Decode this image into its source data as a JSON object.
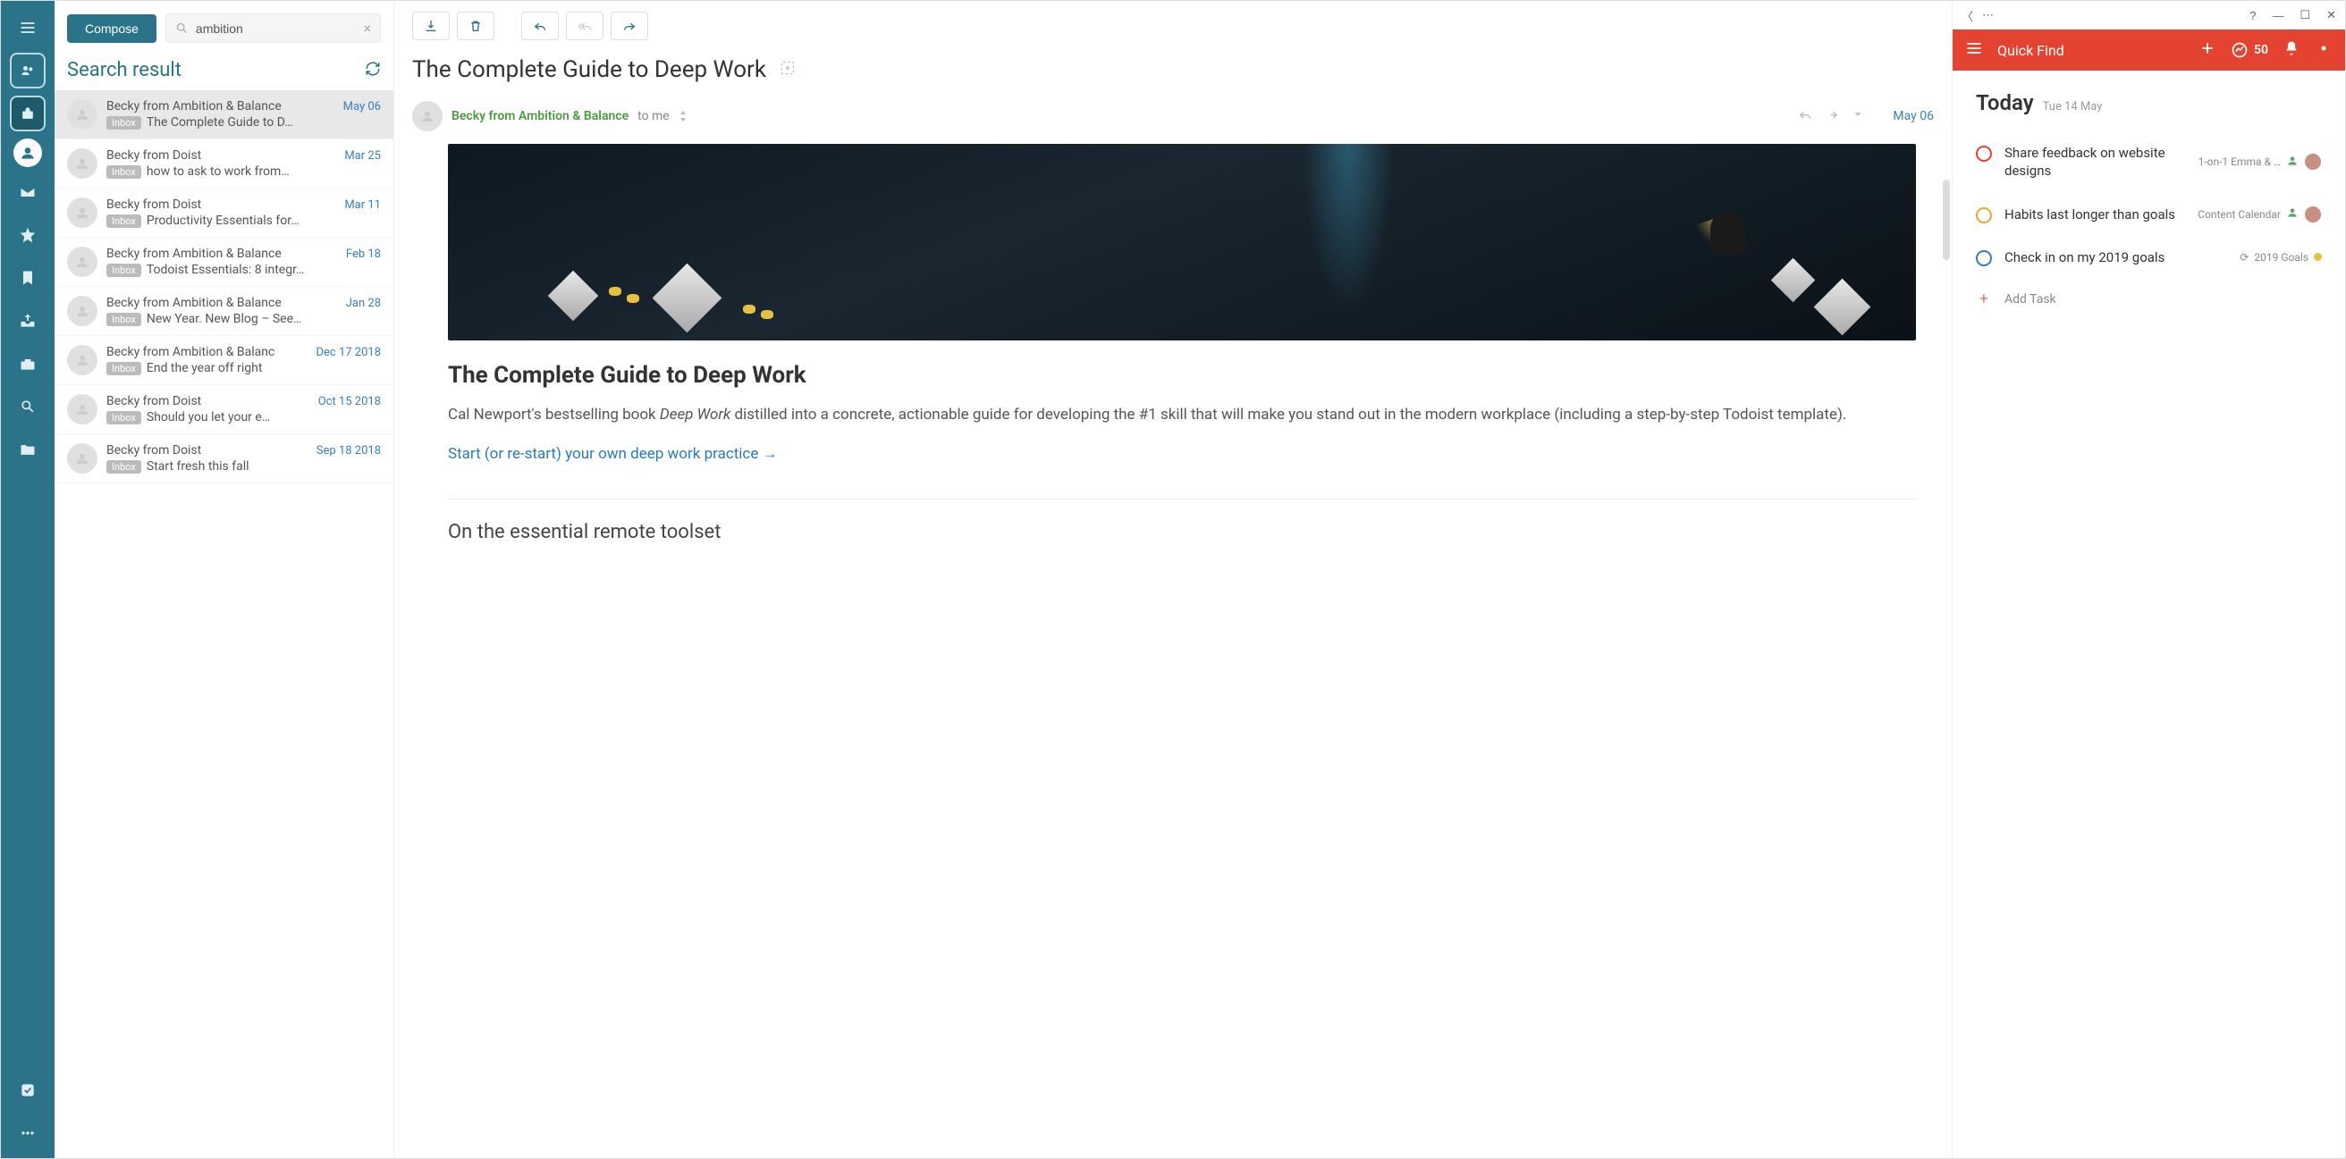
{
  "compose_label": "Compose",
  "search_value": "ambition",
  "list_title": "Search result",
  "folder_badge": "Inbox",
  "messages": [
    {
      "sender": "Becky from Ambition & Balance",
      "date": "May 06",
      "subject": "The Complete Guide to D…",
      "selected": true
    },
    {
      "sender": "Becky from Doist",
      "date": "Mar 25",
      "subject": "how to ask to work from…"
    },
    {
      "sender": "Becky from Doist",
      "date": "Mar 11",
      "subject": "Productivity Essentials for…"
    },
    {
      "sender": "Becky from Ambition & Balance",
      "date": "Feb 18",
      "subject": "Todoist Essentials: 8 integr…"
    },
    {
      "sender": "Becky from Ambition & Balance",
      "date": "Jan 28",
      "subject": "New Year. New Blog – See…"
    },
    {
      "sender": "Becky from Ambition & Balanc",
      "date": "Dec 17 2018",
      "subject": "End the year off right"
    },
    {
      "sender": "Becky from Doist",
      "date": "Oct 15 2018",
      "subject": "Should you let your e…"
    },
    {
      "sender": "Becky from Doist",
      "date": "Sep 18 2018",
      "subject": "Start fresh this fall"
    }
  ],
  "reader": {
    "subject": "The Complete Guide to Deep Work",
    "sender": "Becky from Ambition & Balance",
    "recipient": "to me",
    "date": "May 06",
    "article_title": "The Complete Guide to Deep Work",
    "article_body_pre": "Cal Newport's bestselling book ",
    "article_body_em": "Deep Work",
    "article_body_post": " distilled into a concrete, actionable guide for developing the #1 skill that will make you stand out in the modern workplace (including a step-by-step Todoist template).",
    "article_link": "Start (or re-start) your own deep work practice →",
    "article_sub": "On the essential remote toolset"
  },
  "todoist": {
    "quick_find": "Quick Find",
    "score": "50",
    "today_label": "Today",
    "today_sub": "Tue 14 May",
    "add_task_label": "Add Task",
    "tasks": [
      {
        "title": "Share feedback on website designs",
        "color": "#e44332",
        "project": "1-on-1 Emma & …",
        "person": true,
        "avatar": true
      },
      {
        "title": "Habits last longer than goals",
        "color": "#e8a33c",
        "project": "Content Calendar",
        "person": true,
        "avatar": true
      },
      {
        "title": "Check in on my 2019 goals",
        "color": "#3a7ab8",
        "project": "2019 Goals",
        "repeat": true,
        "dot": "#e8c040"
      }
    ]
  }
}
